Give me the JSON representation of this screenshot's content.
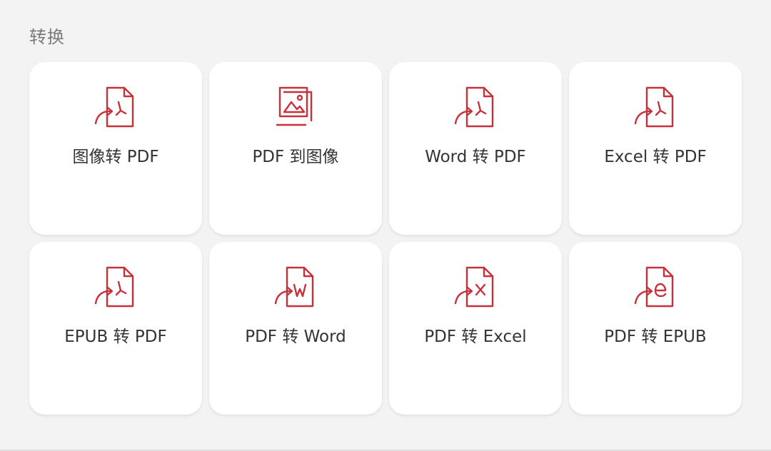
{
  "section": {
    "title": "转换"
  },
  "accent_color": "#c8313a",
  "tiles": [
    {
      "label": "图像转 PDF",
      "icon": "image-to-pdf-icon"
    },
    {
      "label": "PDF 到图像",
      "icon": "pdf-to-image-icon"
    },
    {
      "label": "Word 转 PDF",
      "icon": "word-to-pdf-icon"
    },
    {
      "label": "Excel 转 PDF",
      "icon": "excel-to-pdf-icon"
    },
    {
      "label": "EPUB 转 PDF",
      "icon": "epub-to-pdf-icon"
    },
    {
      "label": "PDF 转 Word",
      "icon": "pdf-to-word-icon"
    },
    {
      "label": "PDF 转 Excel",
      "icon": "pdf-to-excel-icon"
    },
    {
      "label": "PDF 转 EPUB",
      "icon": "pdf-to-epub-icon"
    }
  ]
}
